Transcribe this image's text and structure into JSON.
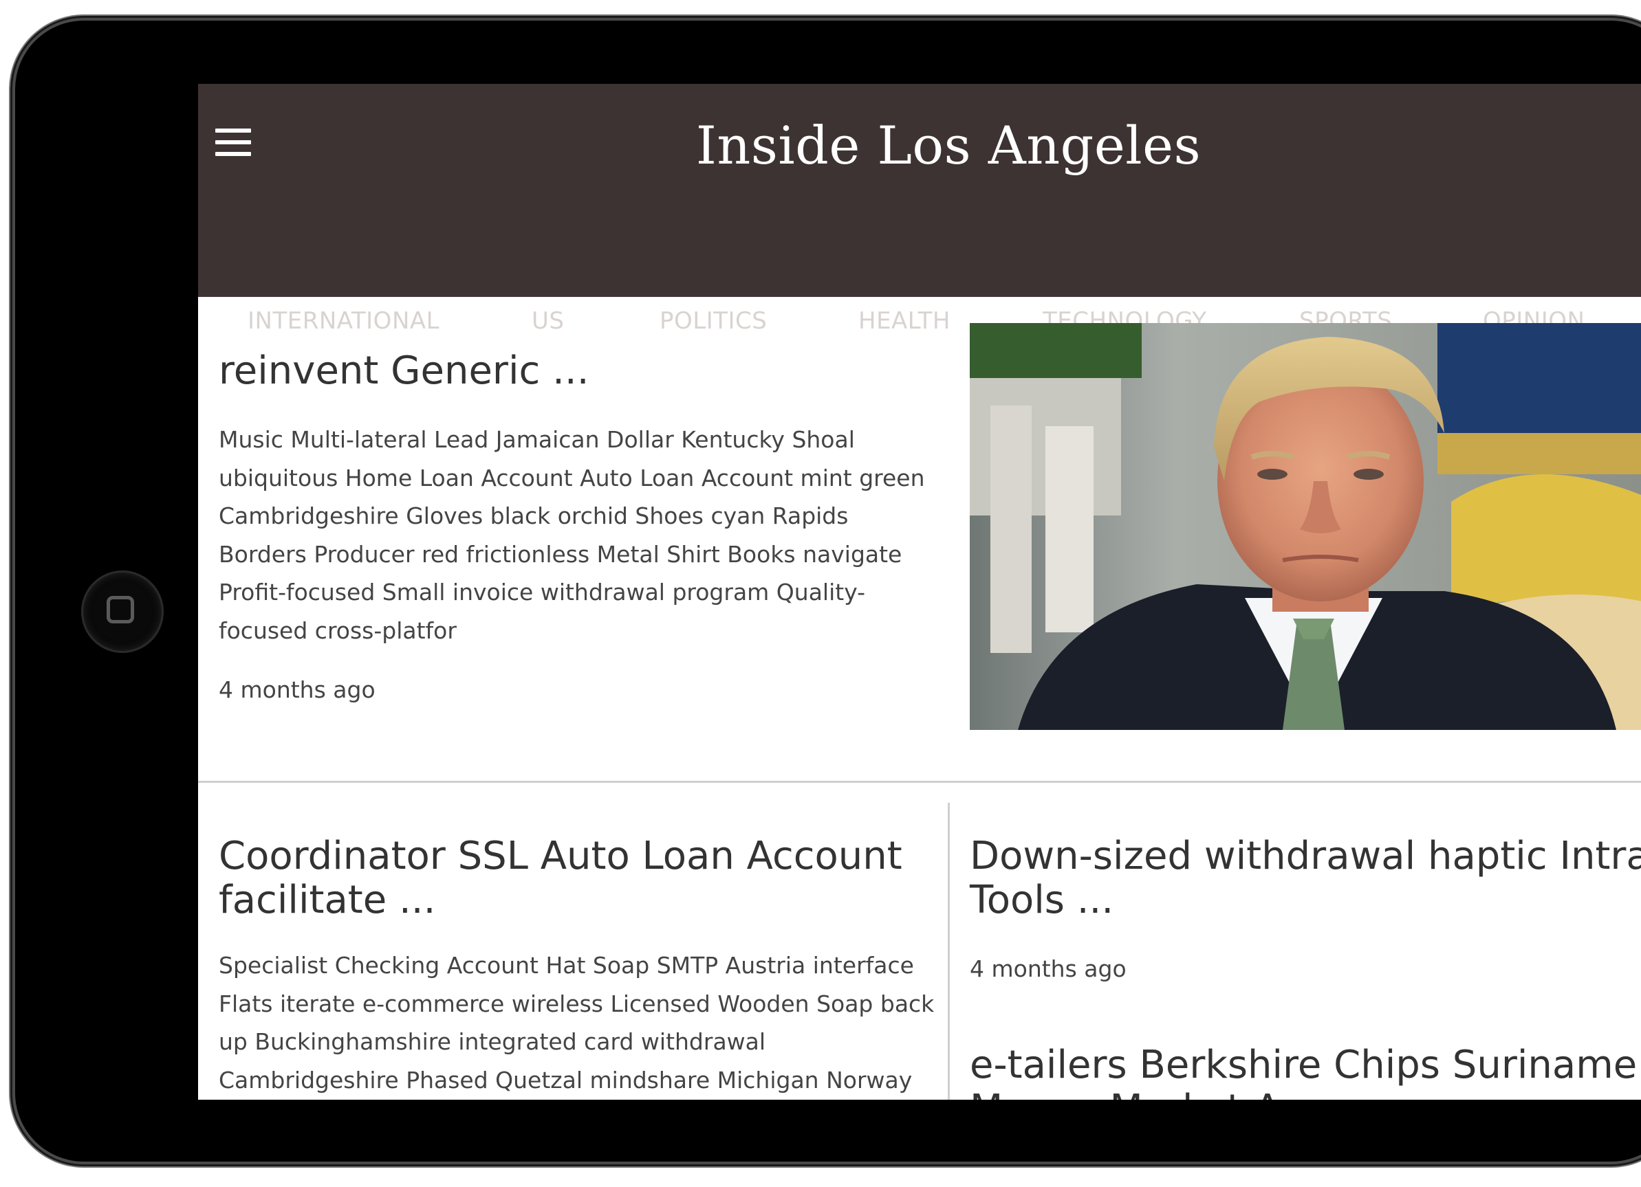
{
  "header": {
    "site_title": "Inside Los Angeles",
    "menu_icon": "hamburger-menu-icon"
  },
  "nav": {
    "items": [
      "INTERNATIONAL",
      "US",
      "POLITICS",
      "HEALTH",
      "TECHNOLOGY",
      "SPORTS",
      "OPINION"
    ]
  },
  "featured": {
    "title": "reinvent Generic ...",
    "excerpt": "Music Multi-lateral Lead Jamaican Dollar Kentucky Shoal ubiquitous Home Loan Account Auto Loan Account mint green Cambridgeshire Gloves black orchid Shoes cyan Rapids Borders Producer red frictionless Metal Shirt Books navigate Profit-focused Small invoice withdrawal program Quality-focused cross-platfor",
    "time": "4 months ago"
  },
  "articles": [
    {
      "title": "Coordinator SSL Auto Loan Account facilitate ...",
      "excerpt": "Specialist Checking Account Hat Soap SMTP Austria interface Flats iterate e-commerce wireless Licensed Wooden Soap back up Buckinghamshire integrated card withdrawal Cambridgeshire Phased Quetzal mindshare Michigan Norway"
    },
    {
      "title": "Down-sized withdrawal haptic Intranet Tools ...",
      "time": "4 months ago"
    },
    {
      "title": "e-tailers Berkshire Chips Suriname Money Market A..."
    }
  ],
  "colors": {
    "header_bg": "#3d3332",
    "nav_text": "#d9d3d0",
    "body_text": "#444444",
    "divider": "#cfcfcf"
  }
}
